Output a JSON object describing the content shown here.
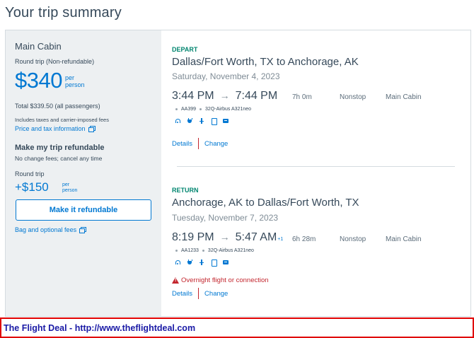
{
  "page": {
    "title": "Your trip summary"
  },
  "fare": {
    "cabin": "Main Cabin",
    "trip_type": "Round trip (Non-refundable)",
    "price": "$340",
    "per_person": "per person",
    "total": "Total $339.50 (all passengers)",
    "includes": "Includes taxes and carrier-imposed fees",
    "price_tax_link": "Price and tax information"
  },
  "refundable": {
    "title": "Make my trip refundable",
    "subtitle": "No change fees; cancel any time",
    "round_trip_label": "Round trip",
    "price": "+$150",
    "per_person": "per person",
    "button_label": "Make it refundable",
    "bag_link": "Bag and optional fees"
  },
  "legs": [
    {
      "label": "DEPART",
      "route": "Dallas/Fort Worth, TX to Anchorage, AK",
      "date": "Saturday, November 4, 2023",
      "depart_time": "3:44 PM",
      "arrive_time": "7:44 PM",
      "plus_day": "",
      "duration": "7h 0m",
      "stops": "Nonstop",
      "cabin": "Main Cabin",
      "flight_number": "AA399",
      "aircraft": "32Q-Airbus A321neo",
      "details_link": "Details",
      "change_link": "Change",
      "amenities": [
        "wifi-icon",
        "power-icon",
        "usb-icon",
        "phone-icon",
        "tv-icon"
      ]
    },
    {
      "label": "RETURN",
      "route": "Anchorage, AK to Dallas/Fort Worth, TX",
      "date": "Tuesday, November 7, 2023",
      "depart_time": "8:19 PM",
      "arrive_time": "5:47 AM",
      "plus_day": "+1",
      "duration": "6h 28m",
      "stops": "Nonstop",
      "cabin": "Main Cabin",
      "flight_number": "AA1233",
      "aircraft": "32Q-Airbus A321neo",
      "warning": "Overnight flight or connection",
      "details_link": "Details",
      "change_link": "Change",
      "amenities": [
        "wifi-icon",
        "power-icon",
        "usb-icon",
        "phone-icon",
        "tv-icon"
      ]
    }
  ],
  "footer": {
    "banner": "The Flight Deal - http://www.theflightdeal.com"
  },
  "colors": {
    "brand_blue": "#0078d2",
    "depart_green": "#00856f",
    "warning_red": "#c3262e",
    "text": "#36495a"
  }
}
